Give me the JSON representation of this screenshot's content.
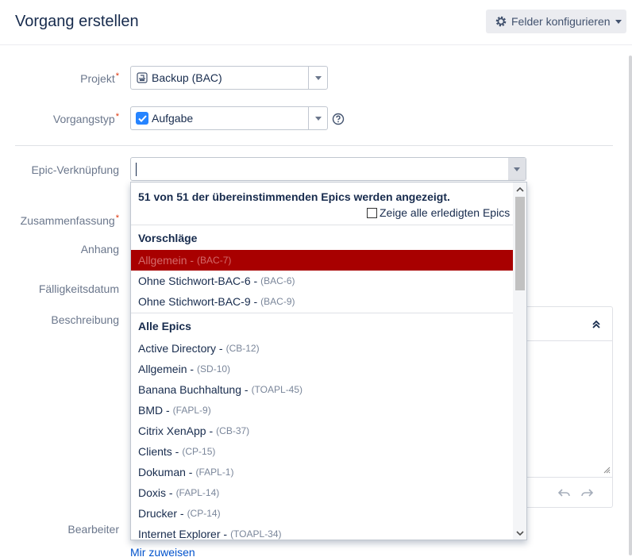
{
  "header": {
    "title": "Vorgang erstellen",
    "config_button": "Felder konfigurieren"
  },
  "fields": {
    "project_label": "Projekt",
    "project_value": "Backup (BAC)",
    "issue_type_label": "Vorgangstyp",
    "issue_type_value": "Aufgabe",
    "epic_link_label": "Epic-Verknüpfung",
    "epic_link_value": "",
    "summary_label": "Zusammenfassung",
    "attachment_label": "Anhang",
    "due_date_label": "Fälligkeitsdatum",
    "description_label": "Beschreibung",
    "assignee_label": "Bearbeiter",
    "assign_to_me": "Mir zuweisen",
    "required_marker": "*"
  },
  "dropdown": {
    "summary": "51 von 51 der übereinstimmenden Epics werden angezeigt.",
    "show_done_label": "Zeige alle erledigten Epics",
    "show_done_checked": false,
    "suggestions_header": "Vorschläge",
    "suggestions": [
      {
        "name": "Allgemein -",
        "key": "(BAC-7)"
      },
      {
        "name": "Ohne Stichwort-BAC-6 -",
        "key": "(BAC-6)"
      },
      {
        "name": "Ohne Stichwort-BAC-9 -",
        "key": "(BAC-9)"
      }
    ],
    "all_header": "Alle Epics",
    "all_epics": [
      {
        "name": "Active Directory -",
        "key": "(CB-12)"
      },
      {
        "name": "Allgemein -",
        "key": "(SD-10)"
      },
      {
        "name": "Banana Buchhaltung -",
        "key": "(TOAPL-45)"
      },
      {
        "name": "BMD -",
        "key": "(FAPL-9)"
      },
      {
        "name": "Citrix XenApp -",
        "key": "(CB-37)"
      },
      {
        "name": "Clients -",
        "key": "(CP-15)"
      },
      {
        "name": "Dokuman -",
        "key": "(FAPL-1)"
      },
      {
        "name": "Doxis -",
        "key": "(FAPL-14)"
      },
      {
        "name": "Drucker -",
        "key": "(CP-14)"
      },
      {
        "name": "Internet Explorer -",
        "key": "(TOAPL-34)"
      }
    ]
  },
  "colors": {
    "highlight": "#a80000",
    "link": "#0052cc",
    "required": "#de350b",
    "checkbox_blue": "#2684ff"
  }
}
